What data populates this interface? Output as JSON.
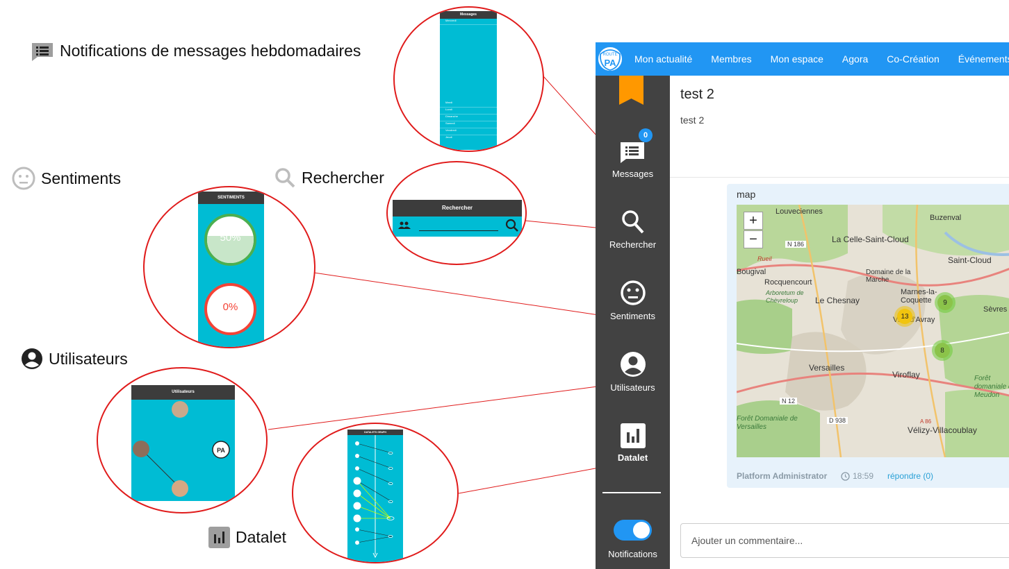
{
  "annotations": {
    "messages": "Notifications de messages hebdomadaires",
    "sentiments": "Sentiments",
    "rechercher": "Rechercher",
    "utilisateurs": "Utilisateurs",
    "datalet": "Datalet"
  },
  "zoom_mockups": {
    "messages_header": "Messages",
    "messages_rows": [
      "Mercredi",
      "Mardi",
      "Lundi",
      "Dimanche",
      "Samedi",
      "Vendredi",
      "Jeudi"
    ],
    "sentiments_header": "SENTIMENTS",
    "sentiment_positive_pct": "50%",
    "sentiment_negative_pct": "0%",
    "rechercher_header": "Rechercher",
    "utilisateurs_header": "Utilisateurs",
    "datalet_header": "DATALETS GRAPH",
    "colors": {
      "teal": "#00bcd4",
      "dark": "#3c3c3c",
      "ring": "#e01b1b",
      "positive": "#4caf50",
      "negative": "#f44336"
    }
  },
  "app": {
    "logo": {
      "top": "ROUTE",
      "main": "PA"
    },
    "nav": [
      "Mon actualité",
      "Membres",
      "Mon espace",
      "Agora",
      "Co-Création",
      "Événements"
    ],
    "sidebar": {
      "messages_label": "Messages",
      "messages_badge": "0",
      "search_label": "Rechercher",
      "sentiments_label": "Sentiments",
      "users_label": "Utilisateurs",
      "datalet_label": "Datalet",
      "notifications_label": "Notifications",
      "notifications_on": true
    },
    "post": {
      "title": "test 2",
      "body": "test 2"
    },
    "card": {
      "heading": "map",
      "author": "Platform Administrator",
      "time": "18:59",
      "reply": "répondre (0)"
    },
    "map": {
      "zoom_in": "+",
      "zoom_out": "−",
      "places": [
        "Louveciennes",
        "Bougival",
        "La Celle-Saint-Cloud",
        "Buzenval",
        "Saint-Cloud",
        "N 186",
        "Rueil",
        "Domaine de la Marche",
        "Marnes-la-Coquette",
        "Rocquencourt",
        "Arboretum de Chèvreloup",
        "Le Chesnay",
        "Sèvres",
        "Ville-d'Avray",
        "Versailles",
        "Viroflay",
        "N 12",
        "D 938",
        "Forêt Domaniale de Versailles",
        "Vélizy-Villacoublay",
        "Forêt domaniale de Meudon",
        "A 86"
      ],
      "clusters": [
        "13",
        "9",
        "8"
      ]
    },
    "comment_placeholder": "Ajouter un commentaire..."
  }
}
